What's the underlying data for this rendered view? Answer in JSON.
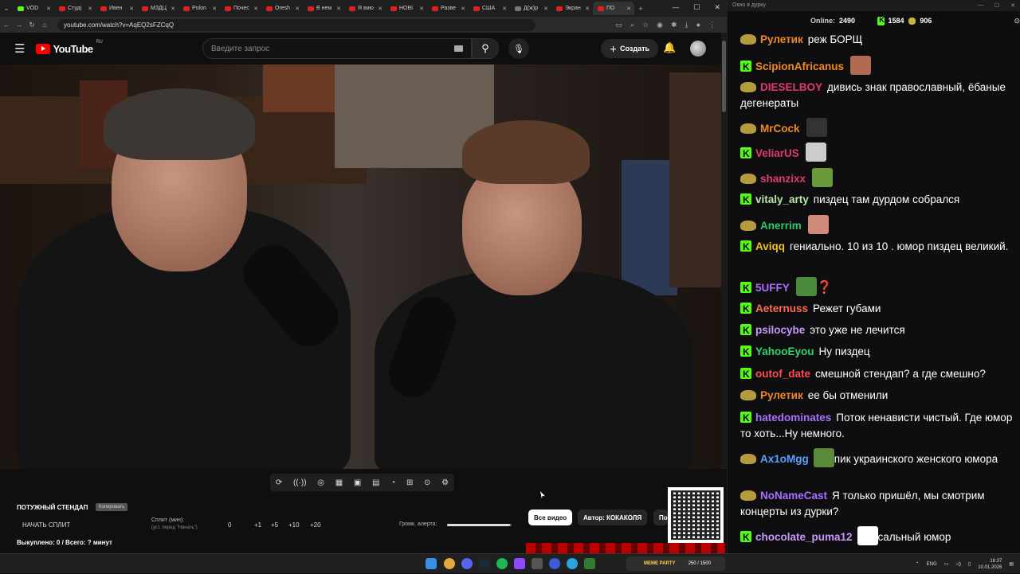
{
  "browser": {
    "tabs": [
      {
        "label": "VOD",
        "fav": "k"
      },
      {
        "label": "Студі",
        "fav": "r"
      },
      {
        "label": "Ивен",
        "fav": "r"
      },
      {
        "label": "МЗДЦ",
        "fav": "r"
      },
      {
        "label": "Polon",
        "fav": "r"
      },
      {
        "label": "Почес",
        "fav": "r"
      },
      {
        "label": "Oresh",
        "fav": "r"
      },
      {
        "label": "В нем",
        "fav": "r"
      },
      {
        "label": "Я вию",
        "fav": "r"
      },
      {
        "label": "НОВІ",
        "fav": "r"
      },
      {
        "label": "Разве",
        "fav": "r"
      },
      {
        "label": "США",
        "fav": "r"
      },
      {
        "label": "Д(ж)р",
        "fav": "g"
      },
      {
        "label": "Экран",
        "fav": "r"
      },
      {
        "label": "ПО",
        "fav": "r"
      }
    ],
    "url": "youtube.com/watch?v=AqEQ2sFZCqQ"
  },
  "youtube": {
    "region": "RU",
    "search_placeholder": "Введите запрос",
    "create_label": "Создать"
  },
  "overlay": {
    "stream_title": "ПОТУЖНЫЙ СТЕНДАП",
    "badge": "Копировать",
    "start_split": "НАЧАТЬ СПЛИТ",
    "split_label": "Сплит (мин):",
    "split_sub": "(уст. перед \"Начать\")",
    "split_values": [
      "0",
      "+1",
      "+5",
      "+10",
      "+20"
    ],
    "alert_label": "Громк. алерта:",
    "alert_volume": 0.98,
    "bought": "Выкуплено: 0 / Всего: ? минут",
    "btn_all": "Все видео",
    "btn_author": "Автор: КОКАКОЛЯ",
    "btn_more": "По"
  },
  "chat": {
    "window_title": "Окно в дурку",
    "online_label": "Online:",
    "online": "2490",
    "kick_count": "1584",
    "coin_count": "906",
    "messages": [
      {
        "badge": "frog",
        "nick": "Рулетик",
        "color": "#f08a24",
        "text": "реж БОРЩ",
        "emote": ""
      },
      {
        "badge": "kick",
        "nick": "ScipionAfricanus",
        "color": "#f08a24",
        "text": "",
        "emote": "face"
      },
      {
        "badge": "frog",
        "nick": "DIESELBOY",
        "color": "#e23a6e",
        "text": "дивись знак православный, ёбаные дегенераты",
        "emote": ""
      },
      {
        "badge": "frog",
        "nick": "MrCock",
        "color": "#f08a24",
        "text": "",
        "emote": "dark"
      },
      {
        "badge": "kick",
        "nick": "VeliarUS",
        "color": "#e23a6e",
        "text": "",
        "emote": "cat"
      },
      {
        "badge": "frog",
        "nick": "shanzixx",
        "color": "#e23a6e",
        "text": "",
        "emote": "frog"
      },
      {
        "badge": "kick",
        "nick": "vitaly_arty",
        "color": "#b9e5a8",
        "text": "пиздец там дурдом собрался",
        "emote": ""
      },
      {
        "badge": "frog",
        "nick": "Anerrim",
        "color": "#34c46b",
        "text": "",
        "emote": "face2"
      },
      {
        "badge": "kick",
        "nick": "Aviqq",
        "color": "#f0c020",
        "text": "гениально. 10 из 10 . юмор пиздец великий.",
        "emote": ""
      },
      {
        "badge": "kick",
        "nick": "5UFFY",
        "color": "#a970ff",
        "text": "",
        "emote": "pepe"
      },
      {
        "badge": "kick",
        "nick": "Aeternuss",
        "color": "#ff6a4d",
        "text": "Режет губами",
        "emote": ""
      },
      {
        "badge": "kick",
        "nick": "psilocybe",
        "color": "#c997ff",
        "text": "это уже не лечится",
        "emote": ""
      },
      {
        "badge": "kick",
        "nick": "YahooEyou",
        "color": "#34d46b",
        "text": "Ну пиздец",
        "emote": ""
      },
      {
        "badge": "kick",
        "nick": "outof_date",
        "color": "#ff4d4d",
        "text": "смешной стендап? а где смешно?",
        "emote": ""
      },
      {
        "badge": "frog",
        "nick": "Рулетик",
        "color": "#f08a24",
        "text": "ее бы отменили",
        "emote": ""
      },
      {
        "badge": "kick",
        "nick": "hatedominates",
        "color": "#a970ff",
        "text": "Поток ненависти чистый. Где юмор то хоть...Ну немного.",
        "emote": ""
      },
      {
        "badge": "frog",
        "nick": "Ax1oMgg",
        "color": "#5aa0ff",
        "text": "пик украинского женского юмора",
        "emote": "frog2"
      },
      {
        "badge": "frog",
        "nick": "NoNameCast",
        "color": "#a970ff",
        "text": "Я только пришёл, мы смотрим концерты из дурки?",
        "emote": ""
      },
      {
        "badge": "kick",
        "nick": "chocolate_puma12",
        "color": "#c997ff",
        "text": "сальный юмор",
        "emote": "ghost"
      }
    ]
  },
  "taskbar": {
    "meme_label": "MEME PARTY",
    "meme_counter": "250 / 1500",
    "lang": "ENG",
    "time": "16:37",
    "date": "10.01.2026"
  }
}
